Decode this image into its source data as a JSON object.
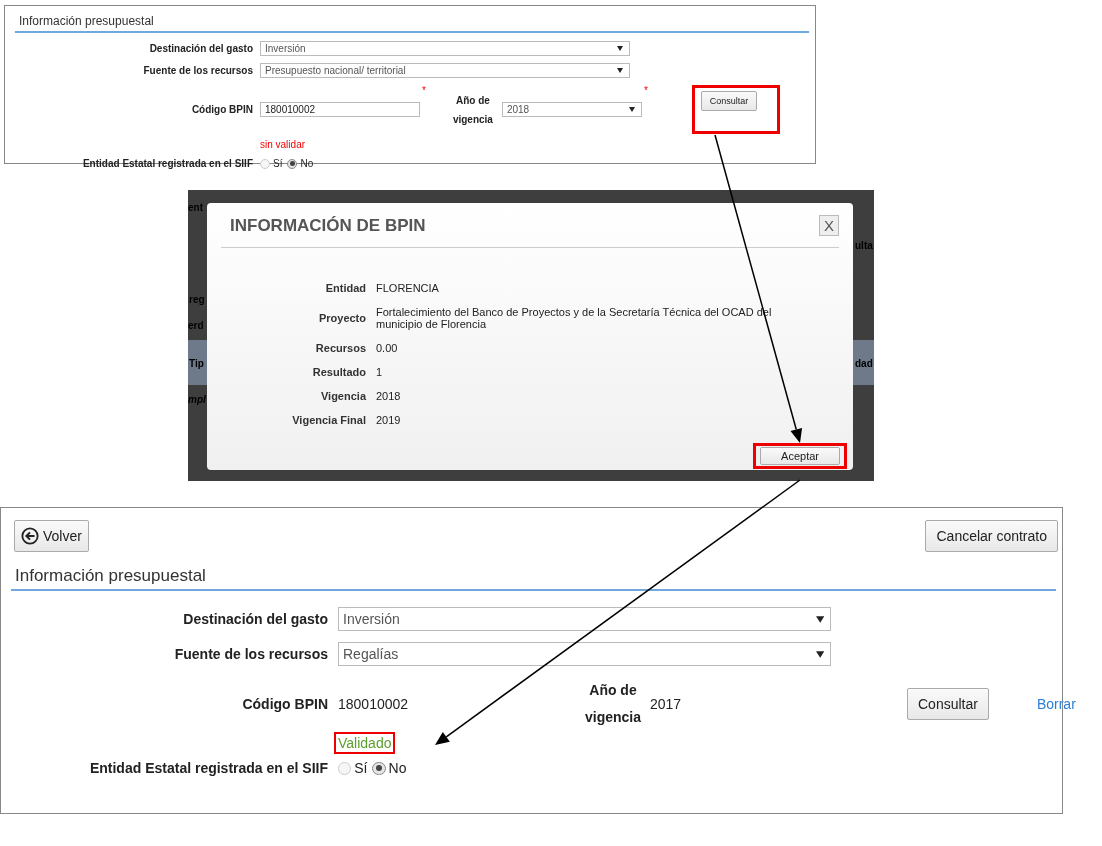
{
  "first_form": {
    "section_title": "Información presupuestal",
    "destination": {
      "label": "Destinación del gasto",
      "kind": "select",
      "value": "Inversión"
    },
    "source": {
      "label": "Fuente de los recursos",
      "kind": "select",
      "value": "Presupuesto nacional/ territorial"
    },
    "bpin": {
      "label": "Código BPIN",
      "kind": "input",
      "value": "180010002",
      "required_mark": "*"
    },
    "year": {
      "label": "Año de vigencia",
      "kind": "select",
      "value": "2018",
      "required_mark": "*"
    },
    "consult_button": {
      "label": "Consultar",
      "highlighted": true
    },
    "status": {
      "text": "sin validar",
      "kind": "error",
      "highlighted": false
    },
    "siif": {
      "label": "Entidad Estatal registrada en el SIIF",
      "options": [
        {
          "label": "Sí",
          "selected": false
        },
        {
          "label": "No",
          "selected": true
        }
      ]
    }
  },
  "dialog": {
    "backdrop_fragments": [
      "ent",
      "reg",
      "erd",
      "Tip",
      "mpl",
      "ulta",
      "dad"
    ],
    "title": "INFORMACIÓN DE BPIN",
    "close": "X",
    "rows": [
      {
        "label": "Entidad",
        "value": "FLORENCIA"
      },
      {
        "label": "Proyecto",
        "value": "Fortalecimiento del Banco de Proyectos y de la Secretaría Técnica del OCAD del municipio de Florencia"
      },
      {
        "label": "Recursos",
        "value": "0.00"
      },
      {
        "label": "Resultado",
        "value": "1"
      },
      {
        "label": "Vigencia",
        "value": "2018"
      },
      {
        "label": "Vigencia Final",
        "value": "2019"
      }
    ],
    "accept_button": {
      "label": "Aceptar",
      "highlighted": true
    }
  },
  "second_form": {
    "back_button": "Volver",
    "cancel_button": "Cancelar contrato",
    "section_title": "Información presupuestal",
    "destination": {
      "label": "Destinación del gasto",
      "kind": "select",
      "value": "Inversión"
    },
    "source": {
      "label": "Fuente de los recursos",
      "kind": "select",
      "value": "Regalías"
    },
    "bpin": {
      "label": "Código BPIN",
      "kind": "text",
      "value": "180010002"
    },
    "year": {
      "label": "Año de vigencia",
      "kind": "text",
      "value": "2017"
    },
    "consult_button": {
      "label": "Consultar",
      "highlighted": false
    },
    "clear_link": "Borrar",
    "status": {
      "text": "Validado",
      "kind": "success",
      "highlighted": true
    },
    "siif": {
      "label": "Entidad Estatal registrada en el SIIF",
      "options": [
        {
          "label": "Sí",
          "selected": false
        },
        {
          "label": "No",
          "selected": true
        }
      ]
    }
  }
}
